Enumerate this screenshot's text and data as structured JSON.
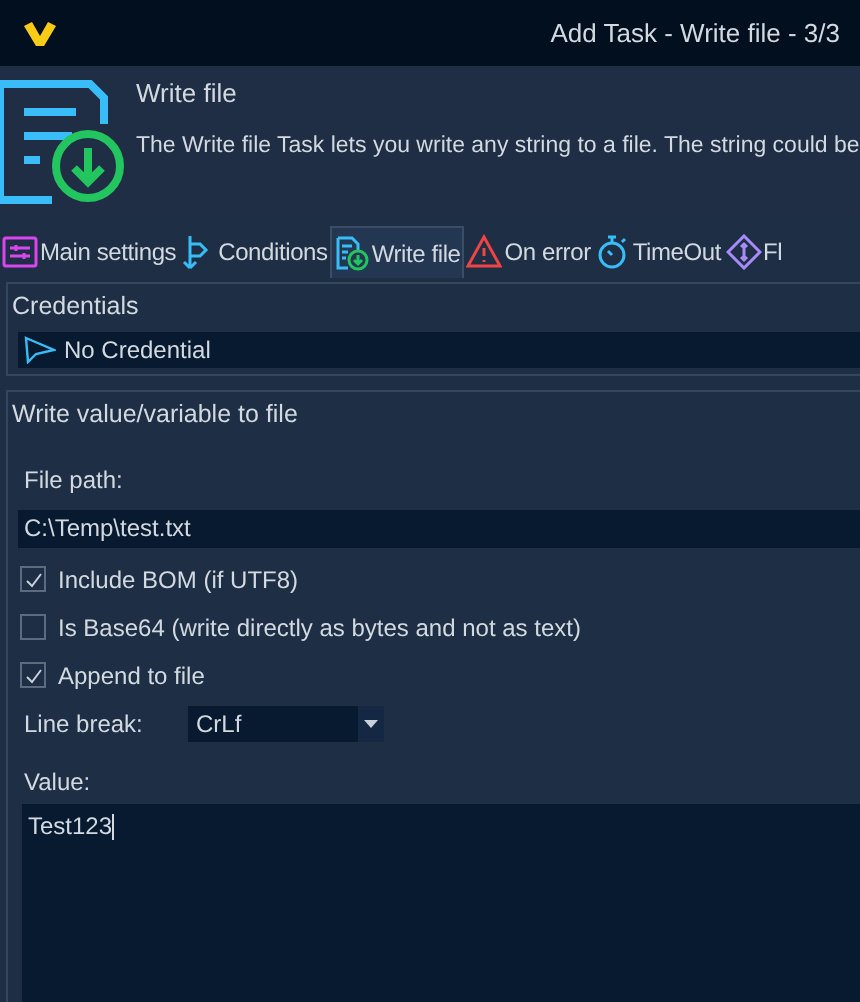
{
  "window": {
    "title": "Add Task - Write file - 3/3"
  },
  "header": {
    "title": "Write file",
    "description": "The Write file Task lets you write any string to a file. The string could be"
  },
  "tabs": [
    {
      "label": "Main settings",
      "kind": "sliders",
      "selected": false
    },
    {
      "label": "Conditions",
      "kind": "fork",
      "selected": false
    },
    {
      "label": "Write file",
      "kind": "file",
      "selected": true
    },
    {
      "label": "On error",
      "kind": "warning",
      "selected": false
    },
    {
      "label": "TimeOut",
      "kind": "stopwatch",
      "selected": false
    },
    {
      "label": "Fl",
      "kind": "diamond",
      "selected": false
    }
  ],
  "credentials": {
    "title": "Credentials",
    "value": "No Credential"
  },
  "write_group": {
    "title": "Write value/variable to file",
    "file_path_label": "File path:",
    "file_path": "C:\\Temp\\test.txt",
    "options": [
      {
        "label": "Include BOM (if UTF8)",
        "checked": true
      },
      {
        "label": "Is Base64 (write directly as bytes and not as text)",
        "checked": false
      },
      {
        "label": "Append to file",
        "checked": true
      }
    ],
    "line_break_label": "Line break:",
    "line_break": "CrLf",
    "value_label": "Value:",
    "value": "Test123"
  }
}
